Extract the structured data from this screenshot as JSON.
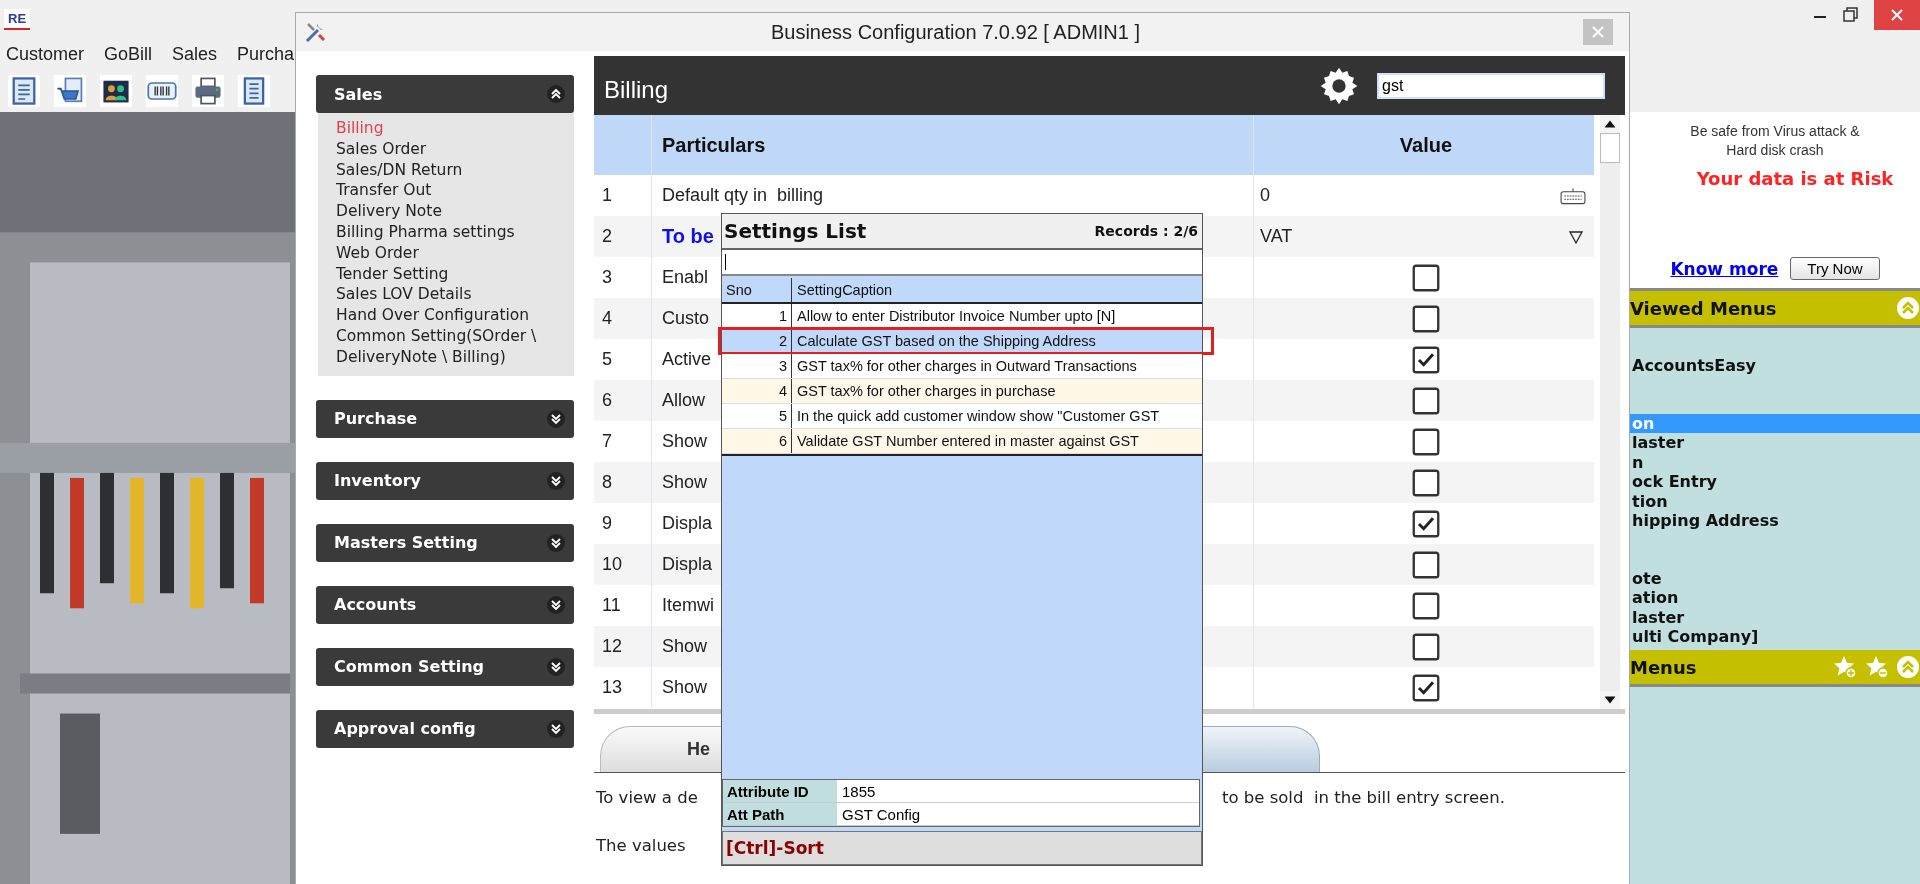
{
  "app": {
    "logo": "RE",
    "menu": [
      {
        "label": "Customer"
      },
      {
        "label": "GoBill"
      },
      {
        "label": "Sales"
      },
      {
        "label": "Purcha"
      }
    ]
  },
  "dialog": {
    "title": "Business Configuration 7.0.92 [ ADMIN1 ]",
    "sidebar": [
      {
        "title": "Sales",
        "expanded": true,
        "items": [
          {
            "label": "Billing",
            "selected": true
          },
          {
            "label": "Sales Order",
            "selected": false
          },
          {
            "label": "Sales/DN Return",
            "selected": false
          },
          {
            "label": "Transfer Out",
            "selected": false
          },
          {
            "label": "Delivery Note",
            "selected": false
          },
          {
            "label": "Billing Pharma settings",
            "selected": false
          },
          {
            "label": "Web Order",
            "selected": false
          },
          {
            "label": "Tender Setting",
            "selected": false
          },
          {
            "label": "Sales LOV Details",
            "selected": false
          },
          {
            "label": "Hand Over Configuration",
            "selected": false
          },
          {
            "label": "Common Setting(SOrder \\ DeliveryNote \\ Billing)",
            "selected": false
          }
        ]
      },
      {
        "title": "Purchase",
        "expanded": false
      },
      {
        "title": "Inventory",
        "expanded": false
      },
      {
        "title": "Masters Setting",
        "expanded": false
      },
      {
        "title": "Accounts",
        "expanded": false
      },
      {
        "title": "Common Setting",
        "expanded": false
      },
      {
        "title": "Approval config",
        "expanded": false
      }
    ],
    "header": {
      "title": "Billing",
      "search": "gst"
    },
    "table": {
      "columns": [
        "Particulars",
        "Value"
      ],
      "rows": [
        {
          "no": "1",
          "particulars": "Default qty in  billing",
          "highlighted": false,
          "kind": "text",
          "value": "0"
        },
        {
          "no": "2",
          "particulars": "To be",
          "highlighted": true,
          "kind": "dropdown",
          "value": "VAT"
        },
        {
          "no": "3",
          "particulars": "Enabl",
          "highlighted": false,
          "kind": "checkbox",
          "checked": false
        },
        {
          "no": "4",
          "particulars": "Custo",
          "highlighted": false,
          "kind": "checkbox",
          "checked": false
        },
        {
          "no": "5",
          "particulars": "Active",
          "highlighted": false,
          "kind": "checkbox",
          "checked": true
        },
        {
          "no": "6",
          "particulars": "Allow",
          "highlighted": false,
          "kind": "checkbox",
          "checked": false
        },
        {
          "no": "7",
          "particulars": "Show",
          "highlighted": false,
          "kind": "checkbox",
          "checked": false
        },
        {
          "no": "8",
          "particulars": "Show",
          "highlighted": false,
          "kind": "checkbox",
          "checked": false
        },
        {
          "no": "9",
          "particulars": "Displa",
          "highlighted": false,
          "kind": "checkbox",
          "checked": true
        },
        {
          "no": "10",
          "particulars": "Displa",
          "highlighted": false,
          "kind": "checkbox",
          "checked": false
        },
        {
          "no": "11",
          "particulars": "Itemwi",
          "highlighted": false,
          "kind": "checkbox",
          "checked": false
        },
        {
          "no": "12",
          "particulars": "Show",
          "highlighted": false,
          "kind": "checkbox",
          "checked": false
        },
        {
          "no": "13",
          "particulars": "Show",
          "highlighted": false,
          "kind": "checkbox",
          "checked": true
        }
      ]
    },
    "help_tab": "He",
    "help_text": [
      {
        "left": "To view a de",
        "right": "to be sold  in the bill entry screen."
      },
      {
        "left": "The values"
      }
    ]
  },
  "settings_list": {
    "title": "Settings List",
    "records": "Records : 2/6",
    "columns": [
      "Sno",
      "SettingCaption"
    ],
    "rows": [
      {
        "sno": "1",
        "caption": "Allow to enter Distributor Invoice Number upto [N]",
        "selected": false
      },
      {
        "sno": "2",
        "caption": "Calculate GST based on the Shipping Address",
        "selected": true
      },
      {
        "sno": "3",
        "caption": "GST tax% for other charges in Outward Transactions",
        "selected": false
      },
      {
        "sno": "4",
        "caption": "GST tax% for other charges in purchase",
        "selected": false
      },
      {
        "sno": "5",
        "caption": "In the quick add customer window show \"Customer GST",
        "selected": false
      },
      {
        "sno": "6",
        "caption": "Validate GST Number entered in master against GST",
        "selected": false
      }
    ],
    "attributes": [
      {
        "label": "Attribute ID",
        "value": "1855"
      },
      {
        "label": "Att Path",
        "value": "GST Config"
      }
    ],
    "footer": "[Ctrl]-Sort"
  },
  "side_panel": {
    "ad_lines": [
      "Be safe from Virus attack &",
      "Hard disk crash"
    ],
    "warning": "Your data is at Risk",
    "link": "Know more",
    "button": "Try Now",
    "viewed_menus": {
      "title": "Viewed Menus",
      "expanded": true,
      "groups": [
        [
          {
            "label": "AccountsEasy",
            "selected": false
          }
        ],
        [
          {
            "label": "on",
            "selected": true
          },
          {
            "label": "laster",
            "selected": false
          },
          {
            "label": "n",
            "selected": false
          },
          {
            "label": "ock Entry",
            "selected": false
          },
          {
            "label": "tion",
            "selected": false
          },
          {
            "label": "hipping Address",
            "selected": false
          }
        ],
        [
          {
            "label": "ote",
            "selected": false
          },
          {
            "label": "ation",
            "selected": false
          },
          {
            "label": "laster",
            "selected": false
          },
          {
            "label": "ulti Company]",
            "selected": false
          }
        ]
      ]
    },
    "menus": {
      "title": "Menus",
      "expanded": true
    }
  }
}
